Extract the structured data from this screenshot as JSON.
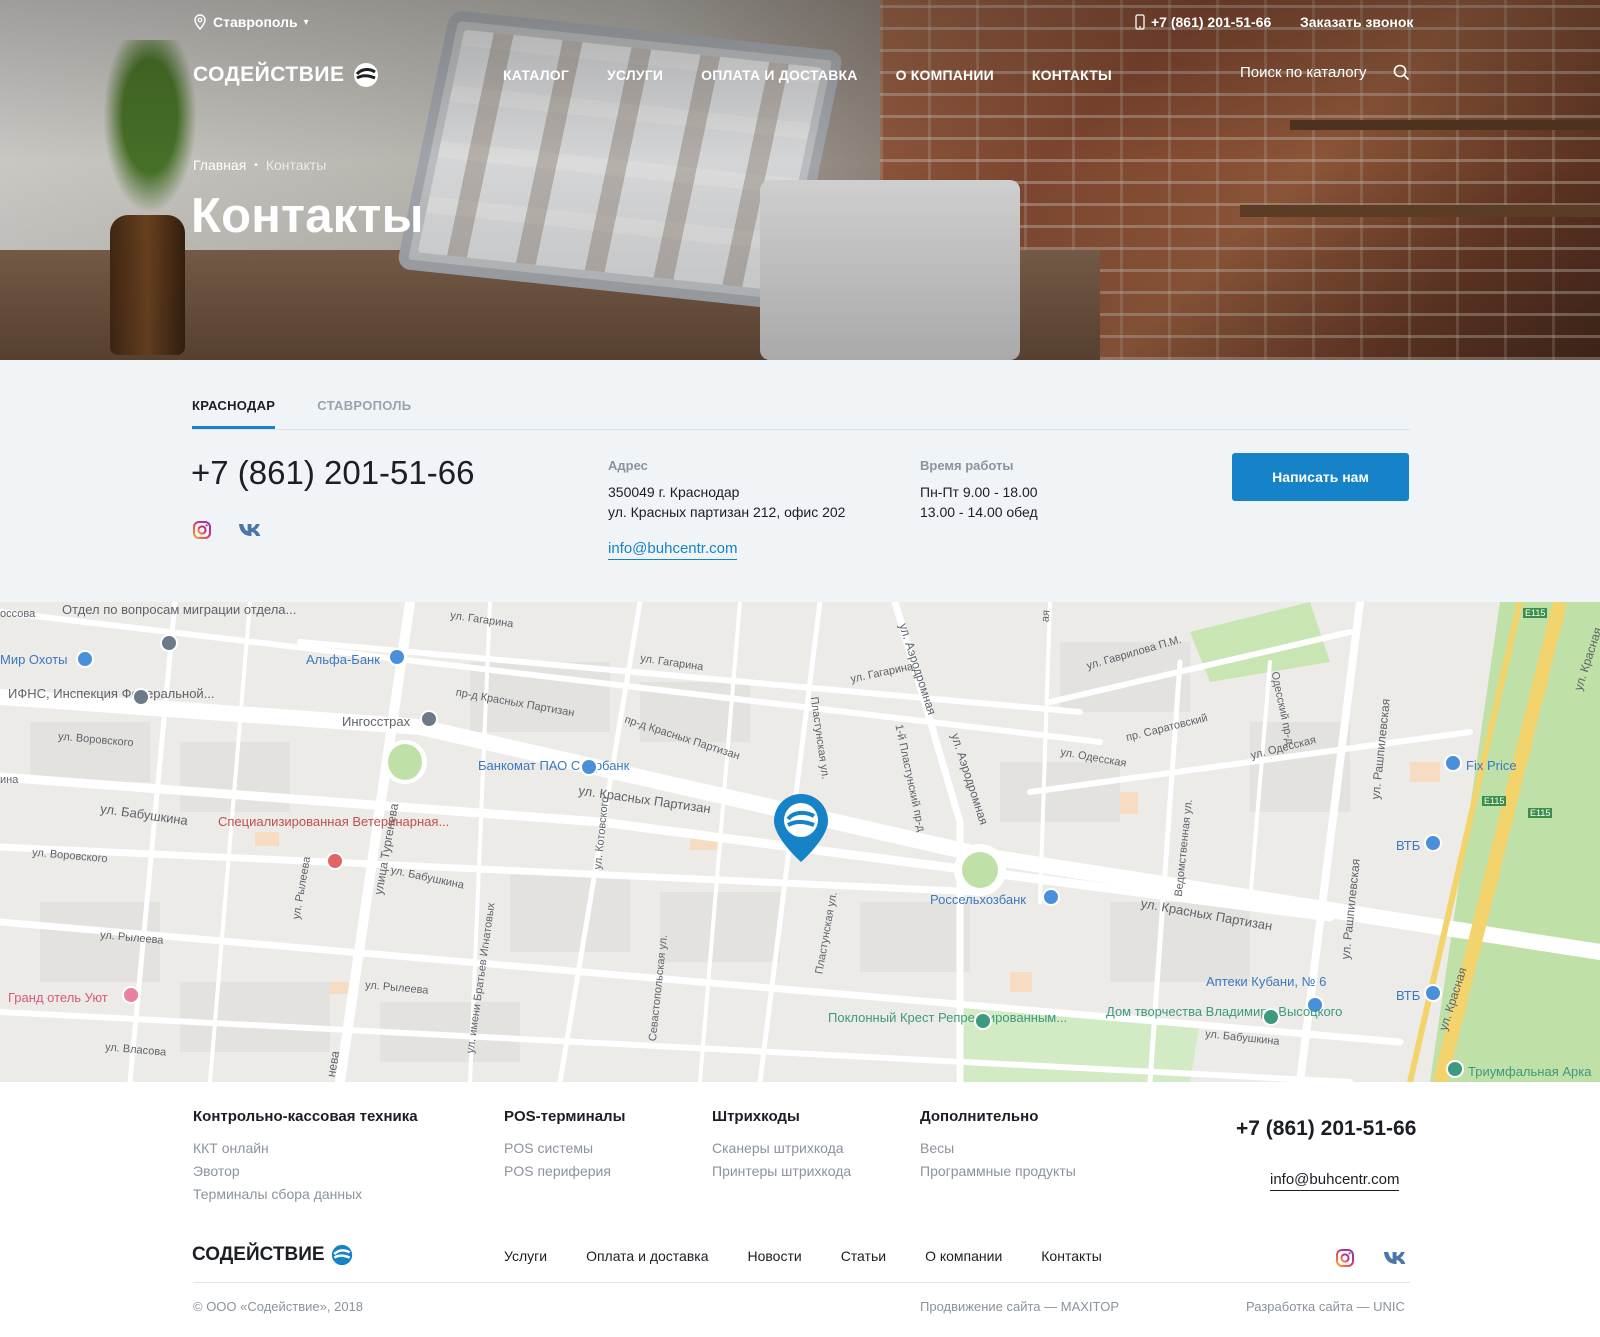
{
  "header": {
    "city": "Ставрополь",
    "phone": "+7 (861) 201-51-66",
    "callback": "Заказать звонок",
    "logo_text": "СОДЕЙСТВИЕ",
    "nav": [
      "КАТАЛОГ",
      "УСЛУГИ",
      "ОПЛАТА И ДОСТАВКА",
      "О КОМПАНИИ",
      "КОНТАКТЫ"
    ],
    "search_placeholder": "Поиск по каталогу"
  },
  "breadcrumb": {
    "home": "Главная",
    "separator": "•",
    "current": "Контакты"
  },
  "page_title": "Контакты",
  "contacts": {
    "tabs": [
      "КРАСНОДАР",
      "СТАВРОПОЛЬ"
    ],
    "active_tab": "КРАСНОДАР",
    "phone": "+7 (861) 201-51-66",
    "address_label": "Адрес",
    "address_line1": "350049 г. Краснодар",
    "address_line2": "ул. Красных партизан 212, офис 202",
    "email": "info@buhcentr.com",
    "hours_label": "Время работы",
    "hours_line1": "Пн-Пт 9.00 - 18.00",
    "hours_line2": "13.00 - 14.00 обед",
    "cta": "Написать нам",
    "social_icons": [
      "instagram-icon",
      "vk-icon"
    ]
  },
  "map": {
    "streets": [
      "ул. Гагарина",
      "ул. Гагарина",
      "ул. Гагарина",
      "пр-д Красных Партизан",
      "пр-д Красных Партизан",
      "ул. Красных Партизан",
      "ул. Красных Партизан",
      "ул. Воровского",
      "ул. Воровского",
      "ул. Бабушкина",
      "ул. Бабушкина",
      "ул. Рылеева",
      "ул. Рылеева",
      "ул. Рылеева",
      "ул. Власова",
      "улица Тургенева",
      "ул. Аэродромная",
      "ул. Аэродромная",
      "Пластунская ул.",
      "Пластунская ул.",
      "1-й Пластунский пр-д",
      "ул. Котовского",
      "ул. имени Братьев Игнатовых",
      "Севастопольская ул.",
      "ул. Одесская",
      "ул. Одесская",
      "пр. Саратовский",
      "Одесский пр-д",
      "ул. Гаврилова П.М.",
      "Ведомственная ул.",
      "ул. Рашпилевская",
      "ул. Рашпилевская",
      "ул. Красная",
      "ул. Красная",
      "ул. Бабушкина",
      "E115",
      "E115",
      "E115",
      "оссова",
      "ина",
      "ая",
      "нева"
    ],
    "pois": [
      {
        "text": "Отдел по вопросам миграции отдела...",
        "color": "gray"
      },
      {
        "text": "Мир Охоты",
        "color": "blue"
      },
      {
        "text": "ИФНС, Инспекция Федеральной...",
        "color": "gray"
      },
      {
        "text": "Альфа-Банк",
        "color": "blue"
      },
      {
        "text": "Ингосстрах",
        "color": "gray"
      },
      {
        "text": "Банкомат ПАО Сбербанк",
        "color": "blue"
      },
      {
        "text": "Специализированная Ветеринарная...",
        "color": "red"
      },
      {
        "text": "Гранд отель Уют",
        "color": "pink"
      },
      {
        "text": "Россельхозбанк",
        "color": "blue"
      },
      {
        "text": "Fix Price",
        "color": "blue"
      },
      {
        "text": "ВТБ",
        "color": "blue"
      },
      {
        "text": "ВТБ",
        "color": "blue"
      },
      {
        "text": "Аптеки Кубани, № 6",
        "color": "blue"
      },
      {
        "text": "Поклонный Крест Репрессированным...",
        "color": "green"
      },
      {
        "text": "Дом творчества Владимира Высоцкого",
        "color": "green"
      },
      {
        "text": "Триумфальная Арка",
        "color": "green"
      }
    ]
  },
  "footer": {
    "columns": [
      {
        "head": "Контрольно-кассовая техника",
        "items": [
          "ККТ онлайн",
          "Эвотор",
          "Терминалы сбора данных"
        ]
      },
      {
        "head": "POS-терминалы",
        "items": [
          "POS системы",
          "POS периферия"
        ]
      },
      {
        "head": "Штрихкоды",
        "items": [
          "Сканеры штрихкода",
          "Принтеры штрихкода"
        ]
      },
      {
        "head": "Дополнительно",
        "items": [
          "Весы",
          "Программные продукты"
        ]
      }
    ],
    "phone": "+7 (861) 201-51-66",
    "email": "info@buhcentr.com",
    "logo_text": "СОДЕЙСТВИЕ",
    "nav": [
      "Услуги",
      "Оплата и доставка",
      "Новости",
      "Статьи",
      "О компании",
      "Контакты"
    ],
    "copyright": "© ООО «Содействие», 2018",
    "promo": "Продвижение сайта — MAXITOP",
    "dev": "Разработка сайта — UNIC"
  },
  "colors": {
    "accent": "#1682c7",
    "panel_bg": "#f1f4f7",
    "text": "#1b1e24",
    "muted": "#8b939c"
  }
}
